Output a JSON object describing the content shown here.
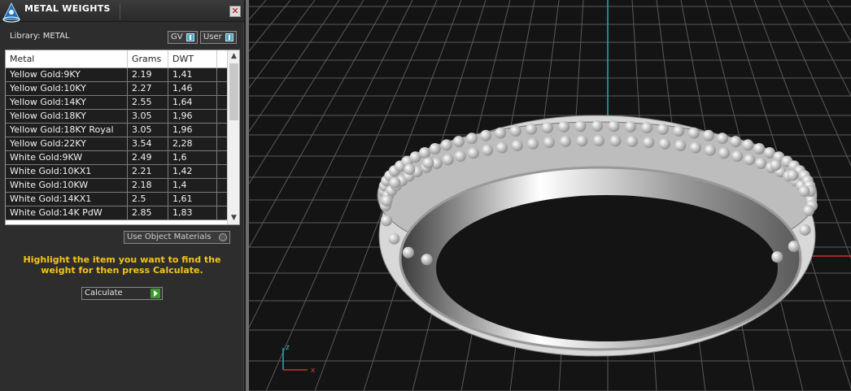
{
  "panel": {
    "title": "METAL WEIGHTS",
    "close_label": "✕",
    "library_label": "Library: METAL",
    "gv_label": "GV",
    "user_label": "User",
    "use_object_materials_label": "Use Object Materials",
    "hint": "Highlight the item you want to find the weight for then press Calculate.",
    "calculate_label": "Calculate"
  },
  "table": {
    "columns": [
      "Metal",
      "Grams",
      "DWT"
    ],
    "rows": [
      {
        "metal": "Yellow Gold:9KY",
        "grams": "2.19",
        "dwt": "1,41"
      },
      {
        "metal": "Yellow Gold:10KY",
        "grams": "2.27",
        "dwt": "1,46"
      },
      {
        "metal": "Yellow Gold:14KY",
        "grams": "2.55",
        "dwt": "1,64"
      },
      {
        "metal": "Yellow Gold:18KY",
        "grams": "3.05",
        "dwt": "1,96"
      },
      {
        "metal": "Yellow Gold:18KY Royal",
        "grams": "3.05",
        "dwt": "1,96"
      },
      {
        "metal": "Yellow Gold:22KY",
        "grams": "3.54",
        "dwt": "2,28"
      },
      {
        "metal": "White Gold:9KW",
        "grams": "2.49",
        "dwt": "1,6"
      },
      {
        "metal": "White Gold:10KX1",
        "grams": "2.21",
        "dwt": "1,42"
      },
      {
        "metal": "White Gold:10KW",
        "grams": "2.18",
        "dwt": "1,4"
      },
      {
        "metal": "White Gold:14KX1",
        "grams": "2.5",
        "dwt": "1,61"
      },
      {
        "metal": "White Gold:14K PdW",
        "grams": "2.85",
        "dwt": "1,83"
      }
    ]
  },
  "viewport": {
    "axis_z_label": "z",
    "axis_x_label": "x"
  },
  "colors": {
    "hint_text": "#f5c518",
    "grid": "#5a5a5a",
    "axis_y": "#2aa7b8",
    "axis_x": "#c0392b"
  }
}
